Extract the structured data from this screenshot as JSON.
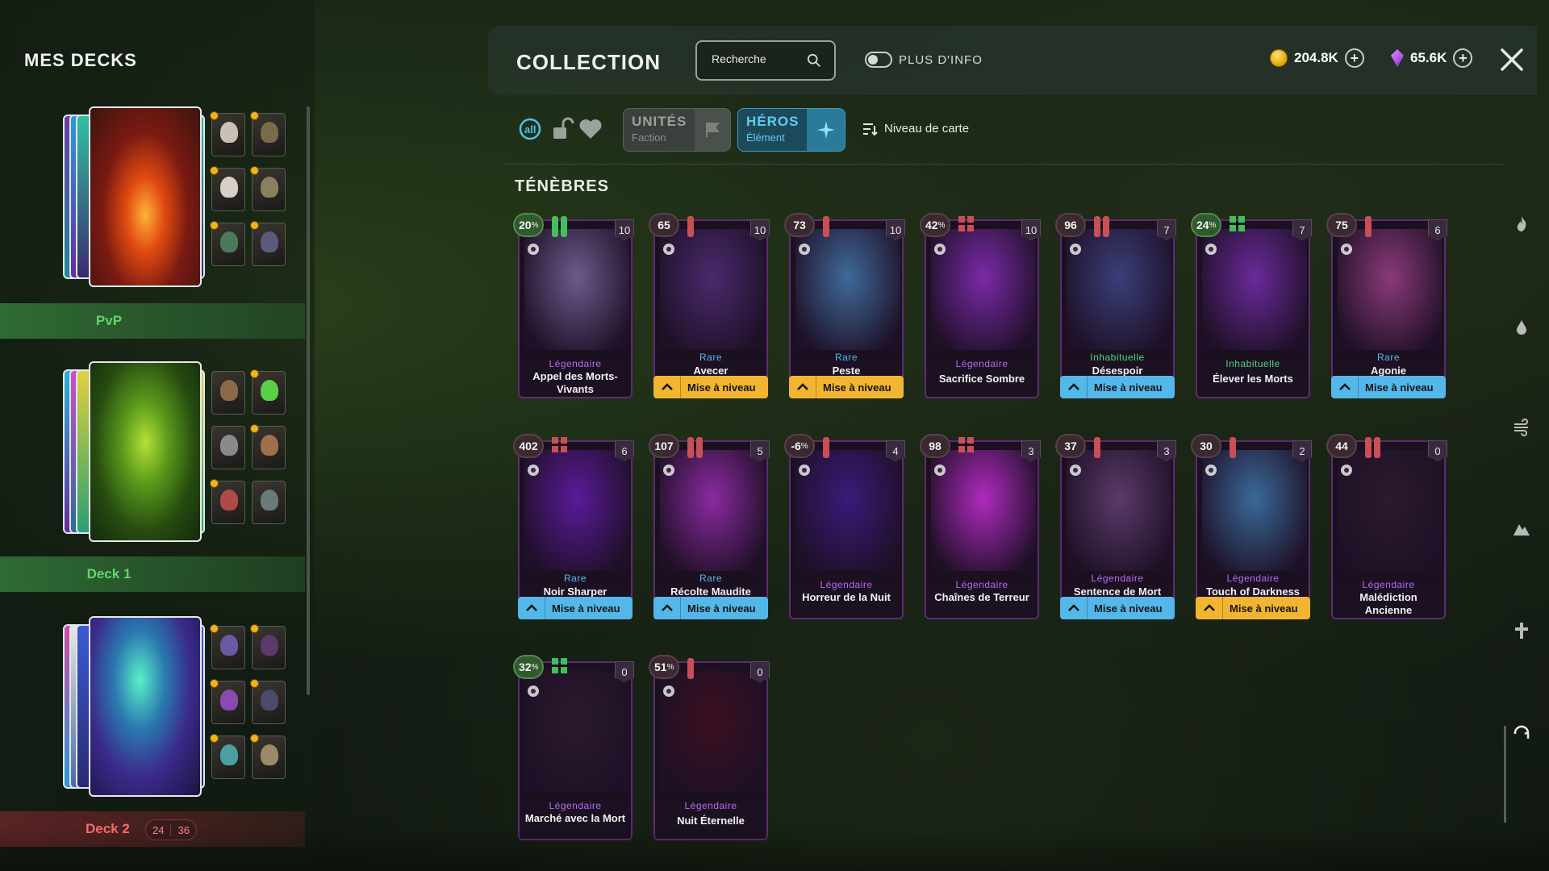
{
  "decks": {
    "title": "MES DECKS",
    "items": [
      {
        "label": "PvP",
        "label_color": "#66d36b",
        "bar_color": "#2f6b35"
      },
      {
        "label": "Deck 1",
        "label_color": "#66d36b",
        "bar_color": "#2f6b35"
      },
      {
        "label": "Deck 2",
        "label_color": "#ff6b6b",
        "bar_color": "#5b2324",
        "counter_current": "24",
        "counter_max": "36"
      }
    ]
  },
  "header": {
    "title": "COLLECTION",
    "search_placeholder": "Recherche",
    "toggle_label": "PLUS D'INFO",
    "gold": "204.8K",
    "gems": "65.6K"
  },
  "filters": {
    "units_label": "UNITÉS",
    "units_sub": "Faction",
    "heroes_label": "HÉROS",
    "heroes_sub": "Élément",
    "sort_label": "Niveau de carte",
    "active": "heroes"
  },
  "section": {
    "title": "TÉNÈBRES"
  },
  "colors": {
    "legendary": "#b86cf2",
    "rare": "#58b8f0",
    "uncommon": "#4fd67a",
    "upgrade_blue": "#54b7ea",
    "upgrade_gold": "#f1b532"
  },
  "cards": [
    {
      "level": "20",
      "percent": true,
      "cost": "10",
      "rarity": "Légendaire",
      "name": "Appel des Morts-Vivants",
      "upgrade": "",
      "counter": "bars-green",
      "art": "#6d5a8c"
    },
    {
      "level": "65",
      "percent": false,
      "cost": "10",
      "rarity": "Rare",
      "name": "Avecer",
      "upgrade": "Mise à niveau",
      "upgrade_style": "gold",
      "counter": "bar-red",
      "art": "#4a2a6e"
    },
    {
      "level": "73",
      "percent": false,
      "cost": "10",
      "rarity": "Rare",
      "name": "Peste",
      "upgrade": "Mise à niveau",
      "upgrade_style": "gold",
      "counter": "bar-red",
      "art": "#3f6a9a"
    },
    {
      "level": "42",
      "percent": true,
      "cost": "10",
      "rarity": "Légendaire",
      "name": "Sacrifice Sombre",
      "upgrade": "",
      "counter": "grid-red",
      "art": "#7a2aa8"
    },
    {
      "level": "96",
      "percent": false,
      "cost": "7",
      "rarity": "Inhabituelle",
      "name": "Désespoir",
      "upgrade": "Mise à niveau",
      "upgrade_style": "blue",
      "counter": "bars-red",
      "art": "#3a3f7a"
    },
    {
      "level": "24",
      "percent": true,
      "cost": "7",
      "rarity": "Inhabituelle",
      "name": "Élever les Morts",
      "upgrade": "",
      "counter": "grid-green",
      "art": "#6a2a9a"
    },
    {
      "level": "75",
      "percent": false,
      "cost": "6",
      "rarity": "Rare",
      "name": "Agonie",
      "upgrade": "Mise à niveau",
      "upgrade_style": "blue",
      "counter": "bar-red",
      "art": "#8a3a7a"
    },
    {
      "level": "402",
      "percent": false,
      "cost": "6",
      "rarity": "Rare",
      "name": "Noir Sharper",
      "upgrade": "Mise à niveau",
      "upgrade_style": "blue",
      "counter": "grid-red",
      "art": "#5a1a9a"
    },
    {
      "level": "107",
      "percent": false,
      "cost": "5",
      "rarity": "Rare",
      "name": "Récolte Maudite",
      "upgrade": "Mise à niveau",
      "upgrade_style": "blue",
      "counter": "bars-red",
      "art": "#8a2aa0"
    },
    {
      "level": "-6",
      "percent": true,
      "cost": "4",
      "rarity": "Légendaire",
      "name": "Horreur de la Nuit",
      "upgrade": "",
      "counter": "bar-red",
      "art": "#3a1a7a"
    },
    {
      "level": "98",
      "percent": false,
      "cost": "3",
      "rarity": "Légendaire",
      "name": "Chaînes de Terreur",
      "upgrade": "",
      "counter": "grid-red",
      "art": "#b02ac0"
    },
    {
      "level": "37",
      "percent": false,
      "cost": "3",
      "rarity": "Légendaire",
      "name": "Sentence de Mort",
      "upgrade": "Mise à niveau",
      "upgrade_style": "blue",
      "counter": "bar-red",
      "art": "#5a3a6a"
    },
    {
      "level": "30",
      "percent": false,
      "cost": "2",
      "rarity": "Légendaire",
      "name": "Touch of Darkness",
      "upgrade": "Mise à niveau",
      "upgrade_style": "gold",
      "counter": "bar-red",
      "art": "#3a6a9a"
    },
    {
      "level": "44",
      "percent": false,
      "cost": "0",
      "rarity": "Légendaire",
      "name": "Malédiction Ancienne",
      "upgrade": "",
      "counter": "bars-red",
      "art": "#2a1a2e"
    },
    {
      "level": "32",
      "percent": true,
      "cost": "0",
      "rarity": "Légendaire",
      "name": "Marché avec la Mort",
      "upgrade": "",
      "counter": "grid-green",
      "art": "#2a1a2e"
    },
    {
      "level": "51",
      "percent": true,
      "cost": "0",
      "rarity": "Légendaire",
      "name": "Nuit Éternelle",
      "upgrade": "",
      "counter": "bar-red",
      "art": "#3a1020"
    }
  ],
  "rail_icons": [
    "fire-icon",
    "water-icon",
    "wind-icon",
    "earth-icon",
    "holy-icon",
    "dark-icon"
  ]
}
